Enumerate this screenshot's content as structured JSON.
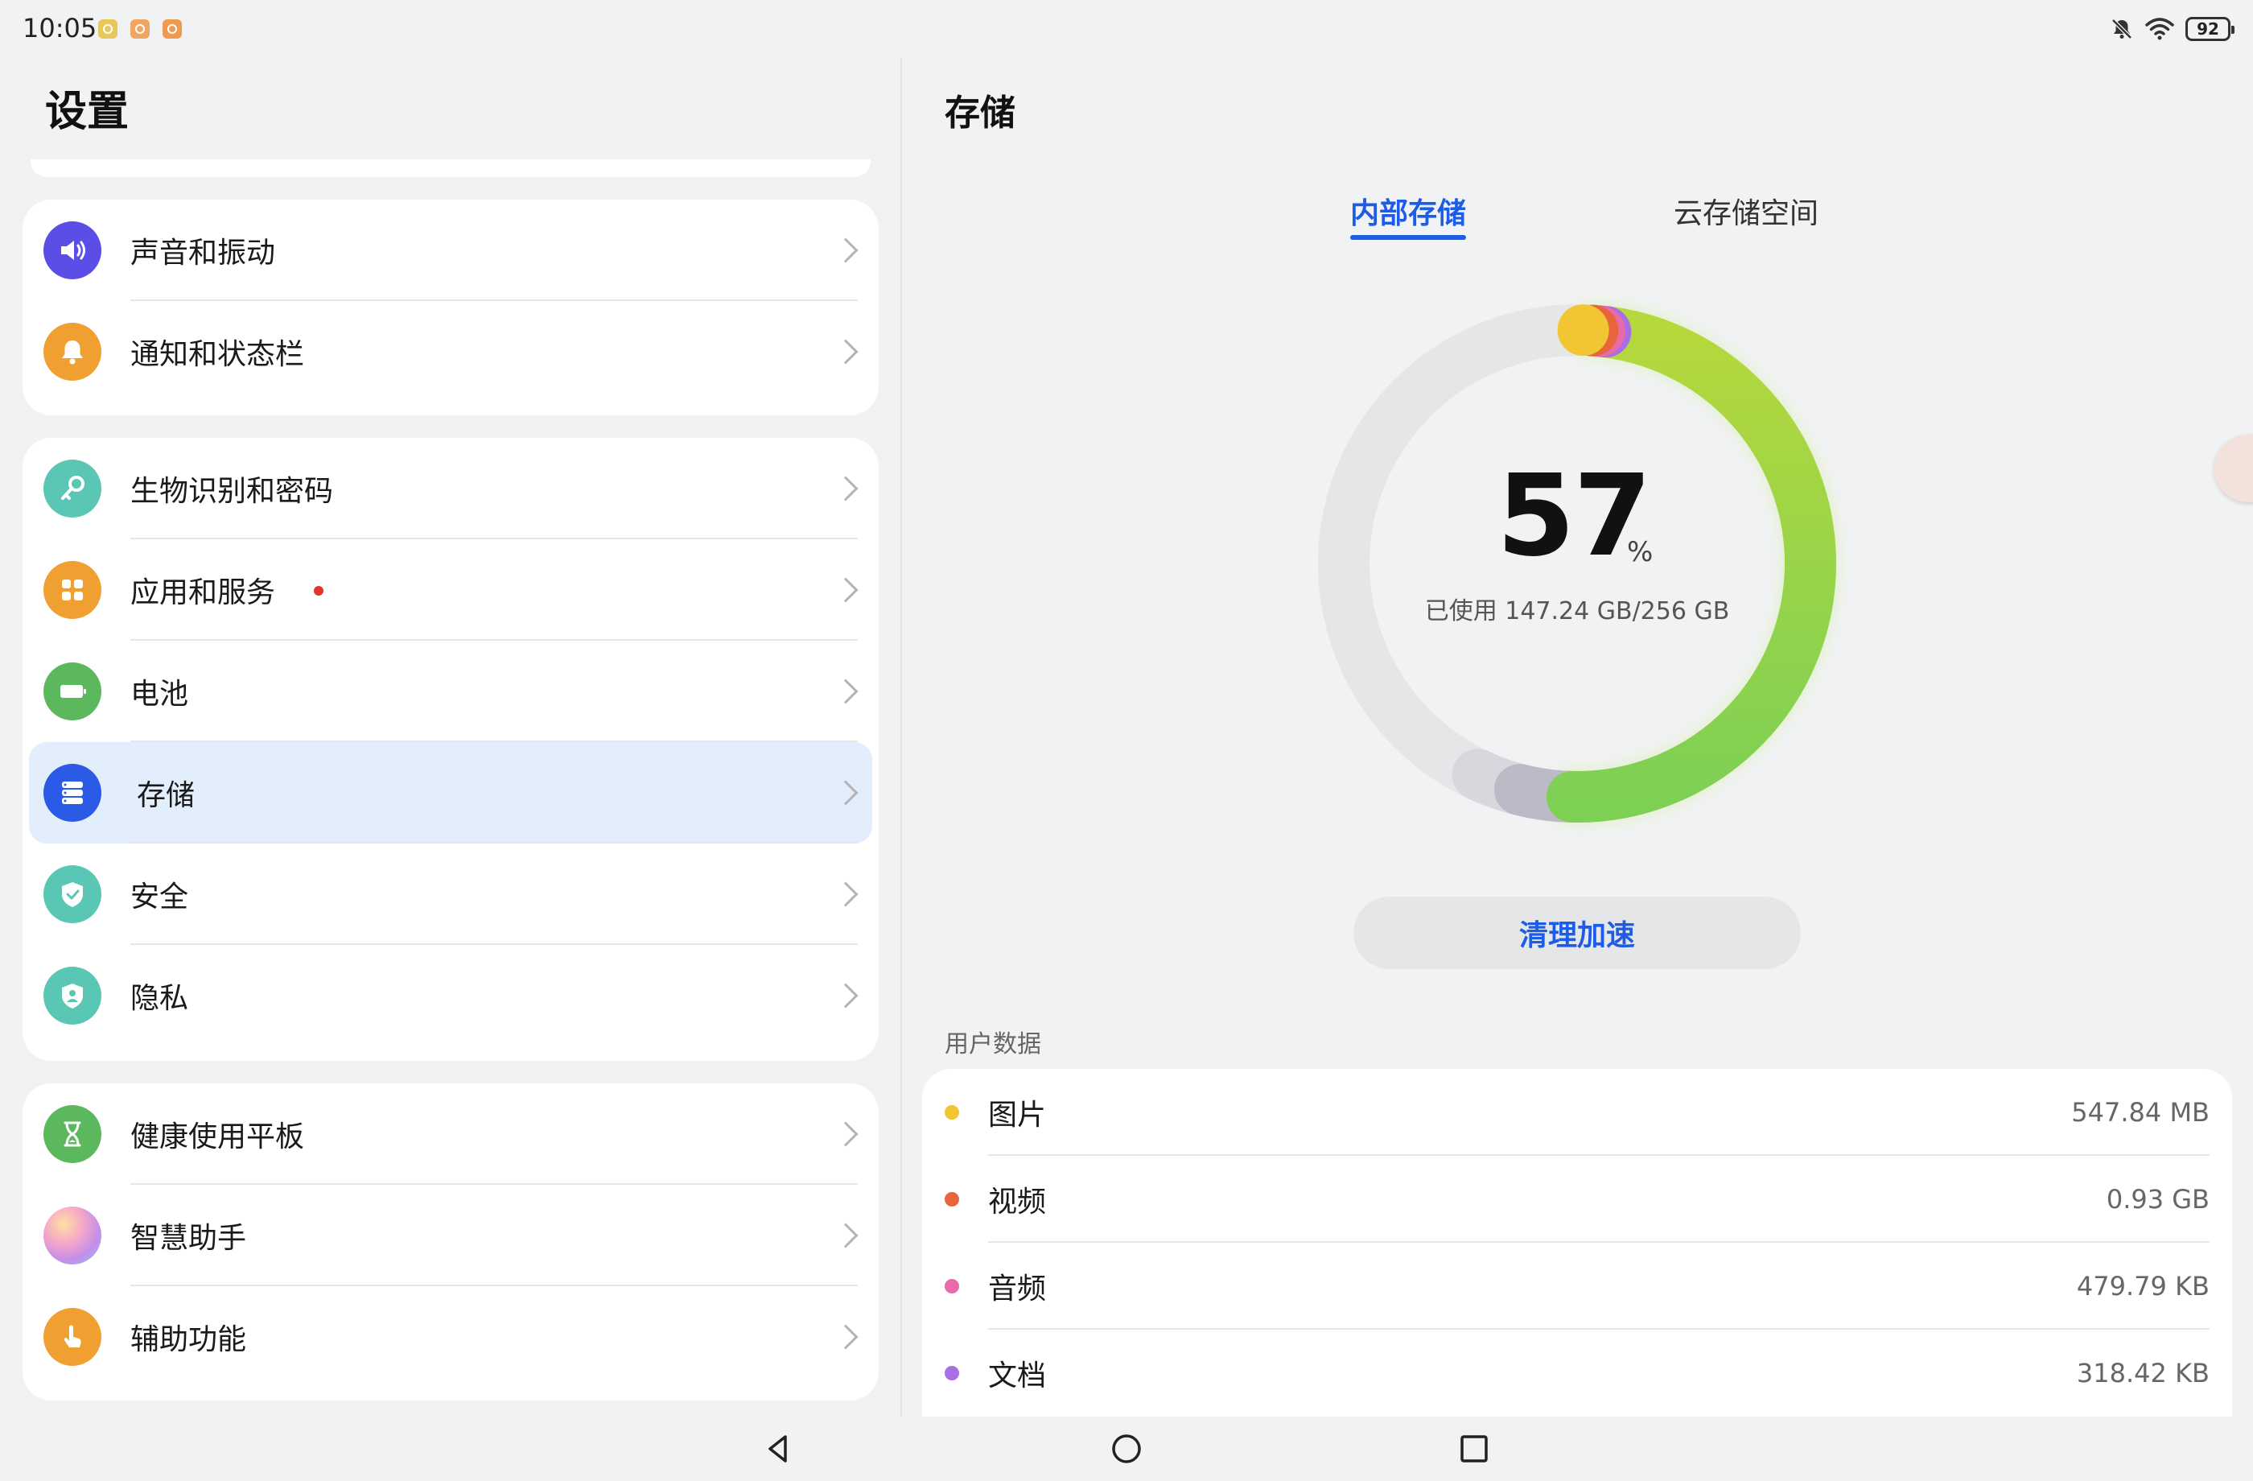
{
  "status_bar": {
    "time": "10:05",
    "battery": "92",
    "icons": [
      "notification-off-icon",
      "wifi-icon",
      "battery-icon"
    ]
  },
  "left": {
    "title": "设置",
    "groups": [
      {
        "items": [
          {
            "label": "声音和振动",
            "icon": "speaker-icon",
            "color": "#5a4ee6"
          },
          {
            "label": "通知和状态栏",
            "icon": "bell-icon",
            "color": "#f0a030"
          }
        ]
      },
      {
        "items": [
          {
            "label": "生物识别和密码",
            "icon": "key-icon",
            "color": "#5ac6b4"
          },
          {
            "label": "应用和服务",
            "icon": "apps-icon",
            "color": "#f0a030",
            "badge": true
          },
          {
            "label": "电池",
            "icon": "battery-icon",
            "color": "#5cb85c"
          },
          {
            "label": "存储",
            "icon": "storage-icon",
            "color": "#2a5ae6",
            "selected": true
          },
          {
            "label": "安全",
            "icon": "shield-check-icon",
            "color": "#5ac6b4"
          },
          {
            "label": "隐私",
            "icon": "privacy-shield-icon",
            "color": "#5ac6b4"
          }
        ]
      },
      {
        "items": [
          {
            "label": "健康使用平板",
            "icon": "hourglass-icon",
            "color": "#5cb85c"
          },
          {
            "label": "智慧助手",
            "icon": "assistant-icon",
            "color": "#c58ee8"
          },
          {
            "label": "辅助功能",
            "icon": "hand-icon",
            "color": "#f0a030"
          }
        ]
      }
    ]
  },
  "right": {
    "title": "存储",
    "tabs": [
      {
        "label": "内部存储",
        "active": true
      },
      {
        "label": "云存储空间",
        "active": false
      }
    ],
    "usage": {
      "percent": "57",
      "percent_sign": "%",
      "used_text": "已使用 147.24 GB/256 GB",
      "fraction": 0.57
    },
    "clean_button": "清理加速",
    "section_label": "用户数据",
    "data_items": [
      {
        "label": "图片",
        "value": "547.84 MB",
        "color": "#f2c532"
      },
      {
        "label": "视频",
        "value": "0.93 GB",
        "color": "#e8643c"
      },
      {
        "label": "音频",
        "value": "479.79 KB",
        "color": "#e86aa8"
      },
      {
        "label": "文档",
        "value": "318.42 KB",
        "color": "#a86ee6"
      }
    ]
  },
  "nav": {
    "icons": [
      "back-icon",
      "home-icon",
      "recents-icon"
    ]
  }
}
